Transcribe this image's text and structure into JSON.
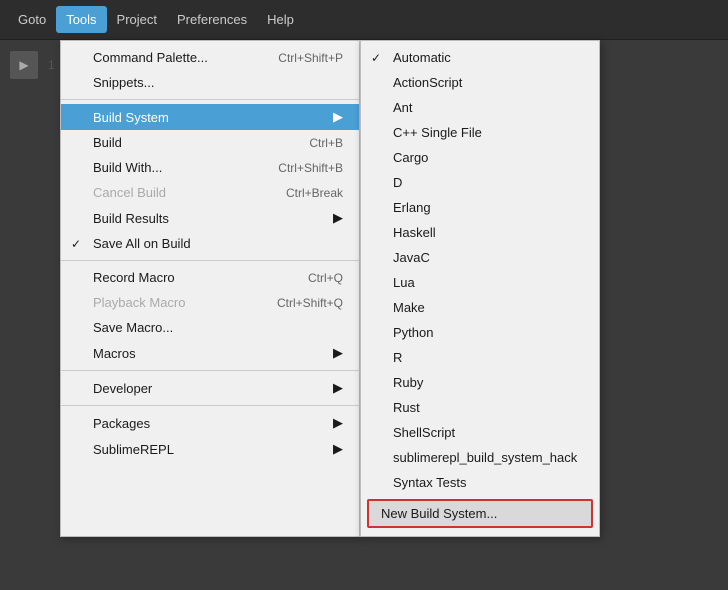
{
  "menubar": {
    "items": [
      "Goto",
      "Tools",
      "Project",
      "Preferences",
      "Help"
    ],
    "active": "Tools"
  },
  "tools_menu": {
    "items": [
      {
        "label": "Command Palette...",
        "shortcut": "Ctrl+Shift+P",
        "type": "normal"
      },
      {
        "label": "Snippets...",
        "shortcut": "",
        "type": "normal"
      },
      {
        "label": "separator"
      },
      {
        "label": "Build System",
        "shortcut": "",
        "type": "submenu",
        "active": true
      },
      {
        "label": "Build",
        "shortcut": "Ctrl+B",
        "type": "normal"
      },
      {
        "label": "Build With...",
        "shortcut": "Ctrl+Shift+B",
        "type": "normal"
      },
      {
        "label": "Cancel Build",
        "shortcut": "Ctrl+Break",
        "type": "disabled"
      },
      {
        "label": "Build Results",
        "shortcut": "",
        "type": "submenu"
      },
      {
        "label": "Save All on Build",
        "shortcut": "",
        "type": "checked"
      },
      {
        "label": "separator"
      },
      {
        "label": "Record Macro",
        "shortcut": "Ctrl+Q",
        "type": "normal"
      },
      {
        "label": "Playback Macro",
        "shortcut": "Ctrl+Shift+Q",
        "type": "disabled"
      },
      {
        "label": "Save Macro...",
        "shortcut": "",
        "type": "normal"
      },
      {
        "label": "Macros",
        "shortcut": "",
        "type": "submenu"
      },
      {
        "label": "separator"
      },
      {
        "label": "Developer",
        "shortcut": "",
        "type": "submenu"
      },
      {
        "label": "separator"
      },
      {
        "label": "Packages",
        "shortcut": "",
        "type": "submenu"
      },
      {
        "label": "SublimeREPL",
        "shortcut": "",
        "type": "submenu"
      }
    ]
  },
  "build_system_menu": {
    "items": [
      {
        "label": "Automatic",
        "checked": true
      },
      {
        "label": "ActionScript",
        "checked": false
      },
      {
        "label": "Ant",
        "checked": false
      },
      {
        "label": "C++ Single File",
        "checked": false
      },
      {
        "label": "Cargo",
        "checked": false
      },
      {
        "label": "D",
        "checked": false
      },
      {
        "label": "Erlang",
        "checked": false
      },
      {
        "label": "Haskell",
        "checked": false
      },
      {
        "label": "JavaC",
        "checked": false
      },
      {
        "label": "Lua",
        "checked": false
      },
      {
        "label": "Make",
        "checked": false
      },
      {
        "label": "Python",
        "checked": false
      },
      {
        "label": "R",
        "checked": false
      },
      {
        "label": "Ruby",
        "checked": false
      },
      {
        "label": "Rust",
        "checked": false
      },
      {
        "label": "ShellScript",
        "checked": false
      },
      {
        "label": "sublimerepl_build_system_hack",
        "checked": false
      },
      {
        "label": "Syntax Tests",
        "checked": false
      },
      {
        "label": "New Build System...",
        "type": "new"
      }
    ]
  },
  "editor": {
    "line_number": "1",
    "play_icon": "▶"
  }
}
